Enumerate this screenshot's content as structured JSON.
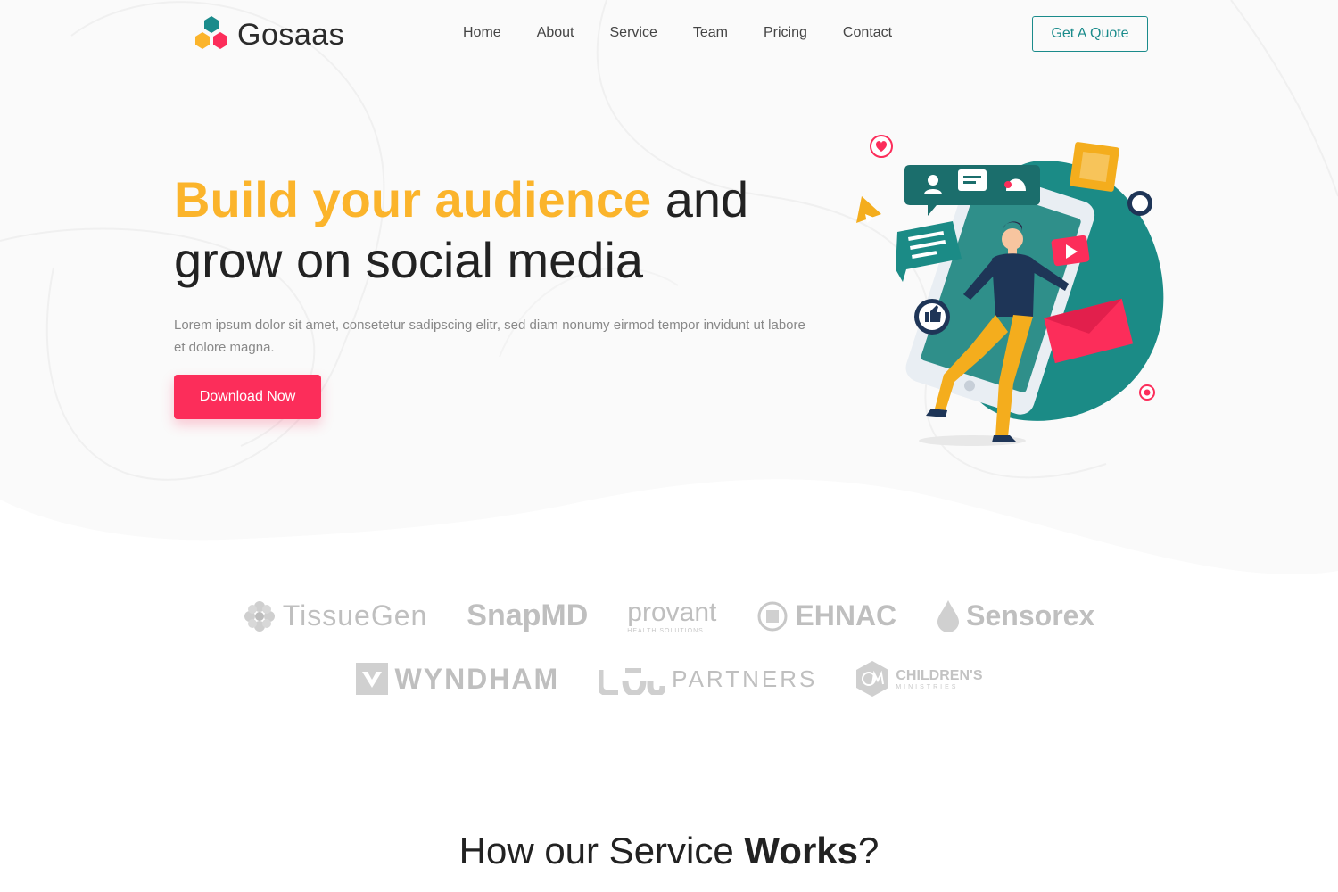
{
  "header": {
    "logo_text": "Gosaas",
    "nav": [
      "Home",
      "About",
      "Service",
      "Team",
      "Pricing",
      "Contact"
    ],
    "quote_label": "Get A Quote"
  },
  "hero": {
    "headline_highlight": "Build your audience",
    "headline_rest_1": " and",
    "headline_line_2": "grow on social media",
    "description": "Lorem ipsum dolor sit amet, consetetur sadipscing elitr, sed diam nonumy eirmod tempor invidunt ut labore et dolore magna.",
    "cta_label": "Download Now"
  },
  "brands": {
    "row1": [
      "TissueGen",
      "SnapMD",
      "provant",
      "EHNAC",
      "Sensorex"
    ],
    "row2": [
      "WYNDHAM",
      "PARTNERS",
      "CHILDREN'S"
    ],
    "provant_sub": "HEALTH SOLUTIONS",
    "childrens_sub": "MINISTRIES"
  },
  "section": {
    "title_prefix": "How our Service ",
    "title_bold": "Works",
    "title_suffix": "?"
  },
  "colors": {
    "accent_yellow": "#fbb42b",
    "accent_pink": "#fc2d5a",
    "accent_teal": "#1a8b8b"
  }
}
